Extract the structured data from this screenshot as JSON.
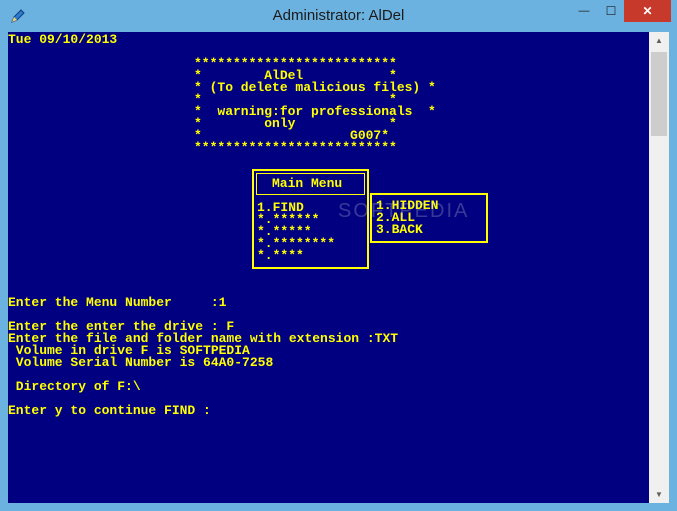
{
  "window": {
    "title": "Administrator:  AlDel",
    "controls": {
      "minimize": "—",
      "maximize": "☐",
      "close": "✕"
    }
  },
  "console": {
    "date_line": "Tue 09/10/2013",
    "banner": [
      "**************************",
      "*        AlDel           *",
      "* (To delete malicious files) *",
      "*                        *",
      "*  warning:for professionals  *",
      "*        only            *",
      "*                   G007*",
      "**************************"
    ],
    "main_menu": {
      "title": "Main Menu",
      "items": [
        "1.FIND",
        "*.******",
        "*.*****",
        "*.********",
        "*.****"
      ]
    },
    "submenu": {
      "items": [
        "1.HIDDEN",
        "2.ALL",
        "3.BACK"
      ]
    },
    "output": [
      "Enter the Menu Number     :1",
      "",
      "Enter the enter the drive : F",
      "Enter the file and folder name with extension :TXT",
      " Volume in drive F is SOFTPEDIA",
      " Volume Serial Number is 64A0-7258",
      "",
      " Directory of F:\\",
      "",
      "Enter y to continue FIND :"
    ]
  },
  "watermark": "SOFTPEDIA",
  "colors": {
    "console_bg": "#000080",
    "console_fg": "#ffff00",
    "frame": "#6cb2e0",
    "close": "#c7392b"
  }
}
